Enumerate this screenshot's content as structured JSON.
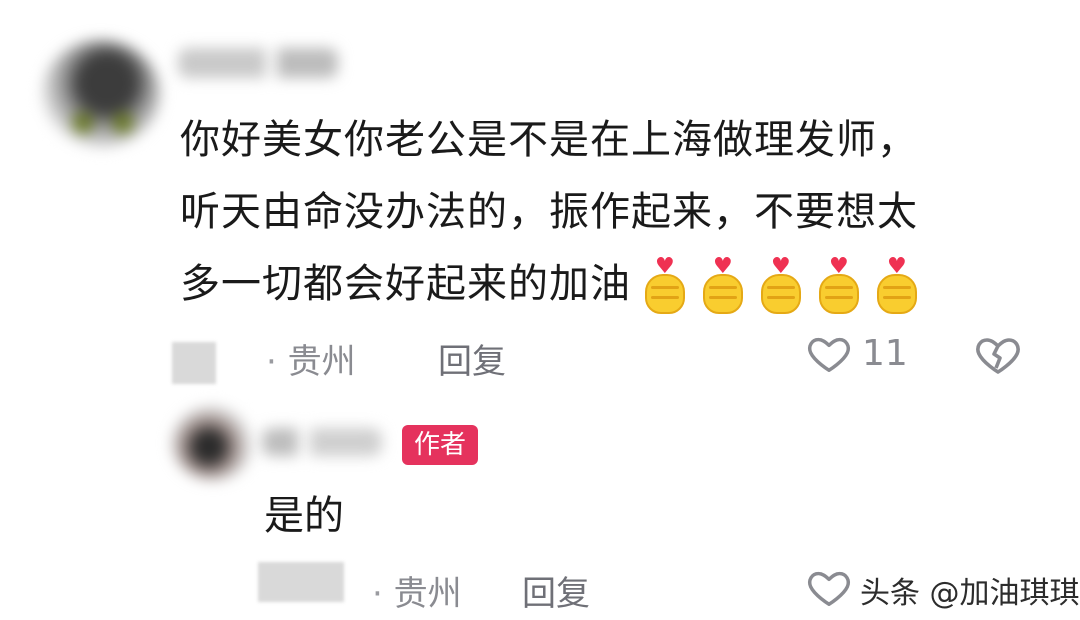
{
  "comment": {
    "text_lines": [
      "你好美女你老公是不是在上海做理发师，",
      "听天由命没办法的，振作起来，不要想太",
      "多一切都会好起来的加油"
    ],
    "emoji_icon": "finger-heart-emoji",
    "emoji_count": 5,
    "location": "贵州",
    "separator": "·",
    "reply_label": "回复",
    "like_count": "11"
  },
  "reply": {
    "author_badge": "作者",
    "text": "是的",
    "location": "贵州",
    "separator": "·",
    "reply_label": "回复"
  },
  "watermark": "头条 @加油琪琪",
  "colors": {
    "badge": "#e5325d",
    "meta_text": "#8a8b91",
    "emoji_heart": "#ef3152",
    "emoji_hand": "#f9cd2f"
  }
}
